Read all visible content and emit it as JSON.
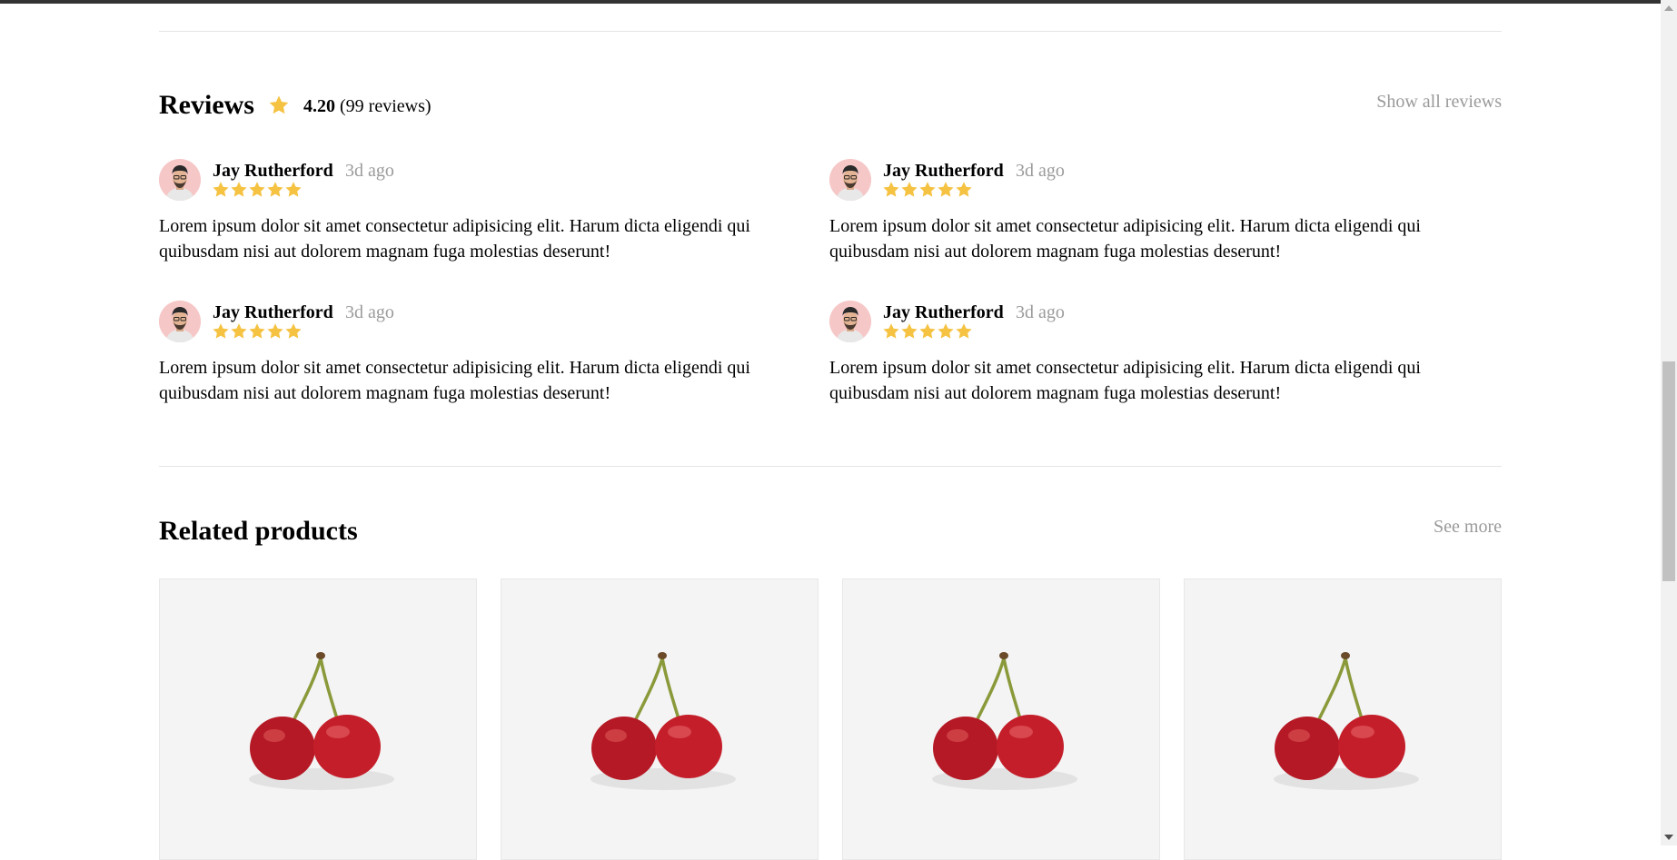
{
  "reviews": {
    "title": "Reviews",
    "rating": "4.20",
    "count": "(99 reviews)",
    "show_all": "Show all reviews",
    "items": [
      {
        "name": "Jay Rutherford",
        "time": "3d ago",
        "stars": 5,
        "text": "Lorem ipsum dolor sit amet consectetur adipisicing elit. Harum dicta eligendi qui quibusdam nisi aut dolorem magnam fuga molestias deserunt!"
      },
      {
        "name": "Jay Rutherford",
        "time": "3d ago",
        "stars": 5,
        "text": "Lorem ipsum dolor sit amet consectetur adipisicing elit. Harum dicta eligendi qui quibusdam nisi aut dolorem magnam fuga molestias deserunt!"
      },
      {
        "name": "Jay Rutherford",
        "time": "3d ago",
        "stars": 5,
        "text": "Lorem ipsum dolor sit amet consectetur adipisicing elit. Harum dicta eligendi qui quibusdam nisi aut dolorem magnam fuga molestias deserunt!"
      },
      {
        "name": "Jay Rutherford",
        "time": "3d ago",
        "stars": 5,
        "text": "Lorem ipsum dolor sit amet consectetur adipisicing elit. Harum dicta eligendi qui quibusdam nisi aut dolorem magnam fuga molestias deserunt!"
      }
    ]
  },
  "related": {
    "title": "Related products",
    "see_more": "See more",
    "products": [
      {
        "image_icon": "cherry-image"
      },
      {
        "image_icon": "cherry-image"
      },
      {
        "image_icon": "cherry-image"
      },
      {
        "image_icon": "cherry-image"
      }
    ]
  },
  "colors": {
    "star": "#f5c242",
    "muted_text": "#9a9a9a",
    "divider": "#e5e5e5",
    "product_bg": "#f4f4f4",
    "cherry": "#c41e2a"
  }
}
